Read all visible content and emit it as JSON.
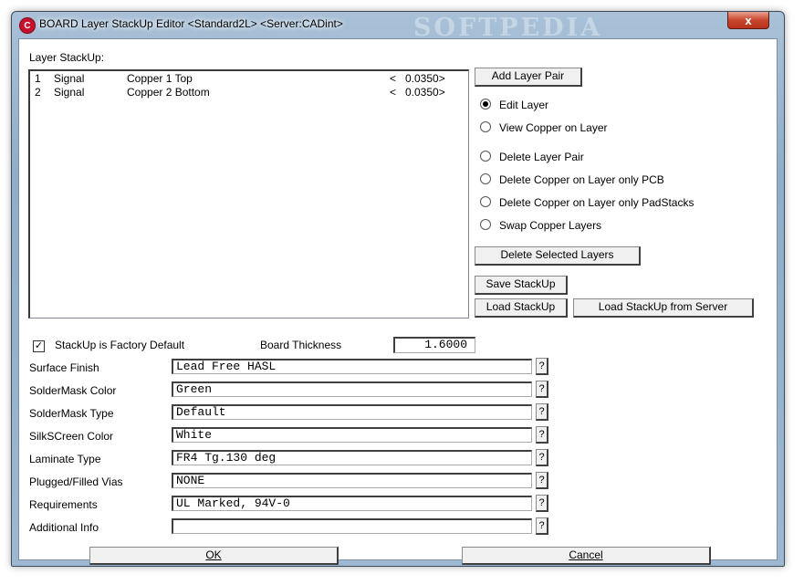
{
  "window": {
    "title": "BOARD Layer StackUp Editor <Standard2L> <Server:CADint>",
    "watermark": "SOFTPEDIA",
    "close_label": "x"
  },
  "stackup": {
    "label": "Layer StackUp:",
    "rows": [
      {
        "num": "1",
        "type": "Signal",
        "name": "Copper  1 Top",
        "lt": "<",
        "value": "0.0350>"
      },
      {
        "num": "2",
        "type": "Signal",
        "name": "Copper  2 Bottom",
        "lt": "<",
        "value": "0.0350>"
      }
    ]
  },
  "buttons": {
    "add_layer_pair": "Add Layer Pair",
    "delete_selected": "Delete Selected Layers",
    "save_stackup": "Save StackUp",
    "load_stackup": "Load StackUp",
    "load_from_server": "Load StackUp from Server",
    "ok": "OK",
    "cancel": "Cancel"
  },
  "modes": [
    {
      "label": "Edit Layer",
      "selected": true
    },
    {
      "label": "View Copper on Layer",
      "selected": false
    },
    {
      "label": "Delete Layer Pair",
      "selected": false
    },
    {
      "label": "Delete Copper on Layer only PCB",
      "selected": false
    },
    {
      "label": "Delete Copper on Layer only PadStacks",
      "selected": false
    },
    {
      "label": "Swap Copper Layers",
      "selected": false
    }
  ],
  "factory_default": {
    "label": "StackUp is Factory Default",
    "checked": true
  },
  "thickness": {
    "label": "Board Thickness",
    "value": "1.6000"
  },
  "properties": [
    {
      "label": "Surface Finish",
      "value": "Lead Free HASL"
    },
    {
      "label": "SolderMask Color",
      "value": "Green"
    },
    {
      "label": "SolderMask Type",
      "value": "Default"
    },
    {
      "label": "SilkSCreen Color",
      "value": "White"
    },
    {
      "label": "Laminate Type",
      "value": "FR4 Tg.130 deg"
    },
    {
      "label": "Plugged/Filled Vias",
      "value": "NONE"
    },
    {
      "label": "Requirements",
      "value": "UL Marked, 94V-0"
    },
    {
      "label": "Additional Info",
      "value": ""
    }
  ],
  "help_label": "?"
}
